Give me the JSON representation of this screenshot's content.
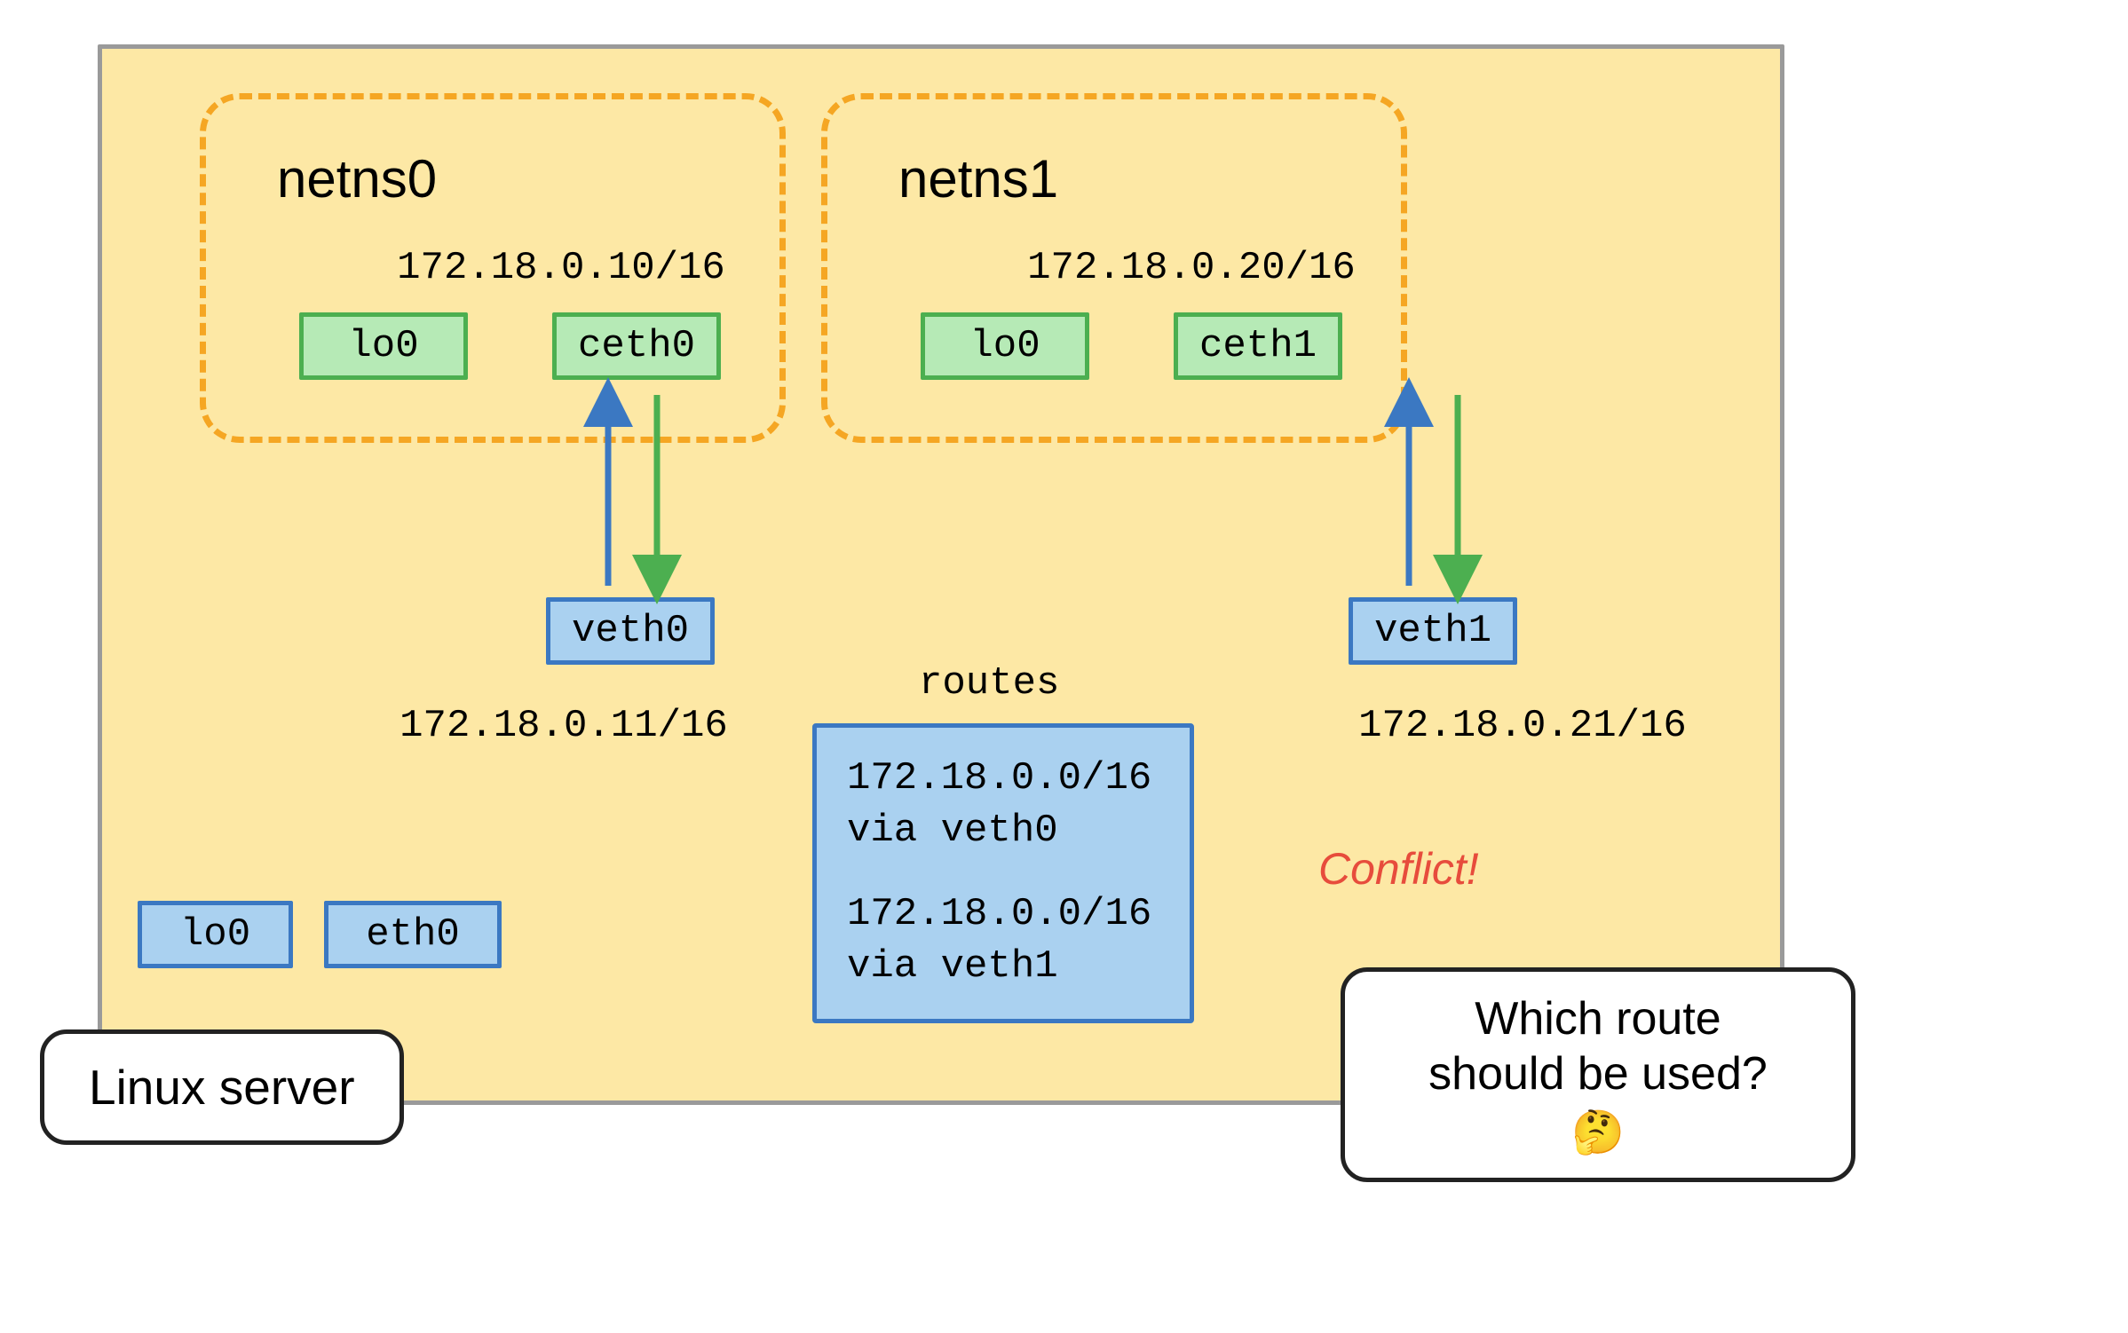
{
  "server": {
    "label": "Linux server",
    "host_lo": "lo0",
    "host_eth": "eth0"
  },
  "netns0": {
    "title": "netns0",
    "ceth_ip": "172.18.0.10/16",
    "lo": "lo0",
    "ceth": "ceth0",
    "veth": "veth0",
    "veth_ip": "172.18.0.11/16"
  },
  "netns1": {
    "title": "netns1",
    "ceth_ip": "172.18.0.20/16",
    "lo": "lo0",
    "ceth": "ceth1",
    "veth": "veth1",
    "veth_ip": "172.18.0.21/16"
  },
  "routes": {
    "title": "routes",
    "r1_line1": "172.18.0.0/16",
    "r1_line2": "via veth0",
    "r2_line1": "172.18.0.0/16",
    "r2_line2": "via veth1"
  },
  "conflict": "Conflict!",
  "bubble": {
    "line1": "Which route",
    "line2": "should be used?",
    "emoji": "🤔"
  }
}
